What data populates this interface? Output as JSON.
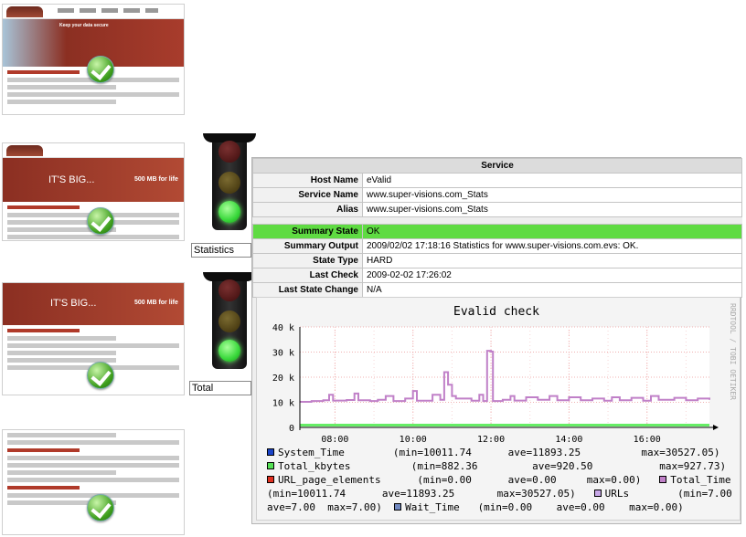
{
  "lights": [
    {
      "label": "Statistics",
      "state": "green"
    },
    {
      "label": "Total",
      "state": "green"
    }
  ],
  "thumbnails": [
    {
      "name": "home",
      "banner_text": "Keep your data secure"
    },
    {
      "name": "backup",
      "banner_text": "IT'S BIG...",
      "banner_sub": "500 MB for life"
    },
    {
      "name": "promo",
      "banner_text": "IT'S BIG...",
      "banner_sub": "500 MB for life"
    },
    {
      "name": "download",
      "banner_text": ""
    }
  ],
  "service": {
    "title": "Service",
    "rows": [
      {
        "key": "Host Name",
        "value": "eValid"
      },
      {
        "key": "Service Name",
        "value": "www.super-visions.com_Stats"
      },
      {
        "key": "Alias",
        "value": "www.super-visions.com_Stats"
      }
    ],
    "status_rows": [
      {
        "key": "Summary State",
        "value": "OK",
        "ok": true
      },
      {
        "key": "Summary Output",
        "value": "2009/02/02 17:18:16 Statistics for www.super-visions.com.evs: OK."
      },
      {
        "key": "State Type",
        "value": "HARD"
      },
      {
        "key": "Last Check",
        "value": "2009-02-02 17:26:02"
      },
      {
        "key": "Last State Change",
        "value": "N/A"
      }
    ]
  },
  "chart_data": {
    "type": "line",
    "title": "Evalid check",
    "side_label": "RRDTOOL / TOBI OETIKER",
    "x_ticks": [
      "08:00",
      "10:00",
      "12:00",
      "14:00",
      "16:00"
    ],
    "y_ticks": [
      "0",
      "10 k",
      "20 k",
      "30 k",
      "40 k"
    ],
    "ylim": [
      0,
      40000
    ],
    "xlim_hours": [
      7.1,
      17.6
    ],
    "series": [
      {
        "name": "URLs",
        "values_k": [
          [
            7.1,
            10.2
          ],
          [
            7.4,
            10.5
          ],
          [
            7.7,
            10.8
          ],
          [
            7.85,
            13
          ],
          [
            7.95,
            10.7
          ],
          [
            8.3,
            10.9
          ],
          [
            8.5,
            13.5
          ],
          [
            8.6,
            10.8
          ],
          [
            8.9,
            10.5
          ],
          [
            9.1,
            11
          ],
          [
            9.3,
            12.5
          ],
          [
            9.5,
            10.5
          ],
          [
            9.8,
            11.5
          ],
          [
            10.0,
            14.5
          ],
          [
            10.1,
            10.6
          ],
          [
            10.5,
            13
          ],
          [
            10.7,
            11
          ],
          [
            10.8,
            22
          ],
          [
            10.9,
            17
          ],
          [
            11.0,
            12.5
          ],
          [
            11.1,
            11.5
          ],
          [
            11.5,
            10.6
          ],
          [
            11.7,
            13
          ],
          [
            11.8,
            10.5
          ],
          [
            11.9,
            30.5
          ],
          [
            12.0,
            30.2
          ],
          [
            12.05,
            10.5
          ],
          [
            12.3,
            11
          ],
          [
            12.5,
            12.5
          ],
          [
            12.6,
            10.7
          ],
          [
            12.9,
            12
          ],
          [
            13.2,
            11
          ],
          [
            13.5,
            12.5
          ],
          [
            13.7,
            10.8
          ],
          [
            14.0,
            12
          ],
          [
            14.3,
            10.8
          ],
          [
            14.6,
            11.5
          ],
          [
            14.9,
            10.6
          ],
          [
            15.1,
            12
          ],
          [
            15.3,
            10.8
          ],
          [
            15.6,
            11.8
          ],
          [
            15.9,
            10.6
          ],
          [
            16.1,
            12.5
          ],
          [
            16.3,
            11
          ],
          [
            16.7,
            11.8
          ],
          [
            17.0,
            10.8
          ],
          [
            17.3,
            11.5
          ],
          [
            17.6,
            11
          ]
        ],
        "color": "#c080c8"
      },
      {
        "name": "Total_kbytes",
        "color": "#66ee66"
      }
    ]
  },
  "legend": [
    {
      "color": "#1a44c8",
      "text": "System_Time        (min=10011.74      ave=11893.25          max=30527.05)"
    },
    {
      "color": "#55e055",
      "text": "Total_kbytes          (min=882.36         ave=920.50           max=927.73)"
    },
    {
      "color": "#e03020",
      "text": "URL_page_elements      (min=0.00      ave=0.00     max=0.00)"
    },
    {
      "color": "#c080c8",
      "text": "Total_Time"
    },
    {
      "color": "",
      "text": "(min=10011.74      ave=11893.25       max=30527.05)"
    },
    {
      "color": "#c8a8e8",
      "text": "URLs        (min=7.00"
    },
    {
      "color": "",
      "text": "ave=7.00  max=7.00)"
    },
    {
      "color": "#7088c0",
      "text": "Wait_Time   (min=0.00    ave=0.00    max=0.00)"
    }
  ]
}
